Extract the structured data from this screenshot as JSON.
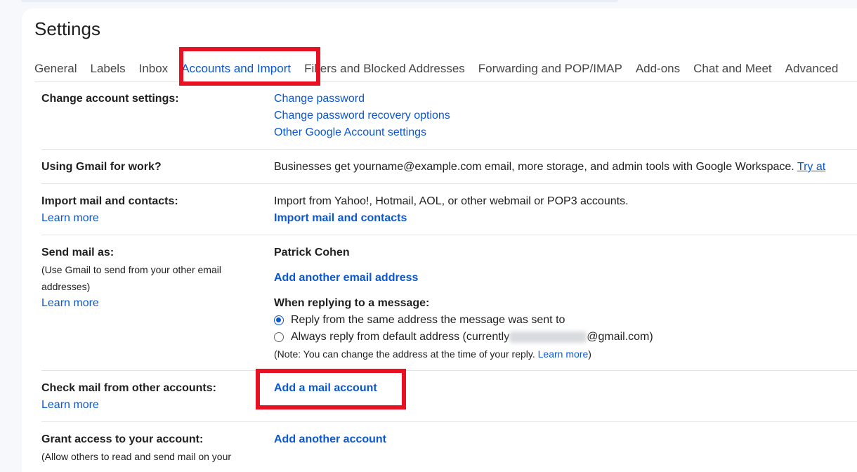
{
  "page": {
    "title": "Settings"
  },
  "tabs": [
    {
      "label": "General"
    },
    {
      "label": "Labels"
    },
    {
      "label": "Inbox"
    },
    {
      "label": "Accounts and Import"
    },
    {
      "label": "Filters and Blocked Addresses"
    },
    {
      "label": "Forwarding and POP/IMAP"
    },
    {
      "label": "Add-ons"
    },
    {
      "label": "Chat and Meet"
    },
    {
      "label": "Advanced"
    }
  ],
  "colors": {
    "link": "#0b57d0",
    "highlight": "#e81123"
  },
  "sections": {
    "change_account": {
      "label": "Change account settings:",
      "links": [
        "Change password",
        "Change password recovery options",
        "Other Google Account settings"
      ]
    },
    "gmail_work": {
      "label": "Using Gmail for work?",
      "text": "Businesses get yourname@example.com email, more storage, and admin tools with Google Workspace.",
      "link": "Try at"
    },
    "import": {
      "label": "Import mail and contacts:",
      "learn_more": "Learn more",
      "text": "Import from Yahoo!, Hotmail, AOL, or other webmail or POP3 accounts.",
      "link": "Import mail and contacts"
    },
    "send_as": {
      "label": "Send mail as:",
      "sub": "(Use Gmail to send from your other email addresses)",
      "learn_more": "Learn more",
      "name": "Patrick Cohen",
      "add_link": "Add another email address",
      "reply_heading": "When replying to a message:",
      "option1": "Reply from the same address the message was sent to",
      "option2_prefix": "Always reply from default address (currently",
      "option2_suffix": "@gmail.com)",
      "note_prefix": "(Note: You can change the address at the time of your reply.",
      "note_link": "Learn more",
      "note_suffix": ")"
    },
    "check_mail": {
      "label": "Check mail from other accounts:",
      "learn_more": "Learn more",
      "link": "Add a mail account"
    },
    "grant_access": {
      "label": "Grant access to your account:",
      "sub": "(Allow others to read and send mail on your",
      "link": "Add another account"
    }
  }
}
